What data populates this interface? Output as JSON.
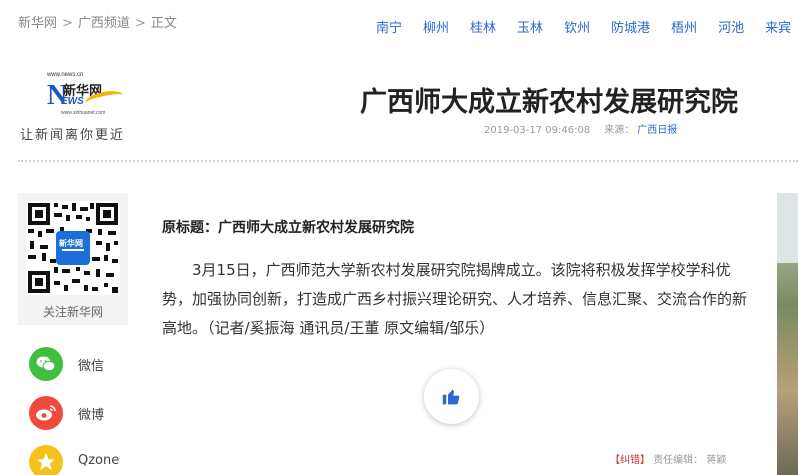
{
  "breadcrumb": {
    "items": [
      "新华网",
      "广西频道",
      "正文"
    ],
    "separator": ">"
  },
  "city_nav": [
    "南宁",
    "柳州",
    "桂林",
    "玉林",
    "钦州",
    "防城港",
    "梧州",
    "河池",
    "来宾"
  ],
  "logo": {
    "url_text": "www.news.cn",
    "brand": "新华网",
    "letter": "N",
    "ews": "EWS",
    "url_text2": "www.xinhuanet.com",
    "slogan": "让新闻离你更近"
  },
  "article": {
    "title": "广西师大成立新农村发展研究院",
    "datetime": "2019-03-17 09:46:08",
    "source_label": "来源：",
    "source": "广西日报",
    "original_title": "原标题：广西师大成立新农村发展研究院",
    "body": "3月15日，广西师范大学新农村发展研究院揭牌成立。该院将积极发挥学校学科优势，加强协同创新，打造成广西乡村振兴理论研究、人才培养、信息汇聚、交流合作的新高地。（记者/奚振海 通讯员/王董 原文编辑/邹乐）",
    "fix_label": "【纠错】",
    "editor": "责任编辑：  蒋颖"
  },
  "share": {
    "qr_label": "关注新华网",
    "qr_badge": "新华网",
    "wechat": "微信",
    "weibo": "微博",
    "qzone": "Qzone"
  },
  "colors": {
    "link_blue": "#2a6ad1",
    "wechat_green": "#3fbf3f",
    "weibo_red": "#ef4a3c",
    "qzone_yellow": "#f4c21b",
    "like_blue": "#2a6ad1"
  }
}
